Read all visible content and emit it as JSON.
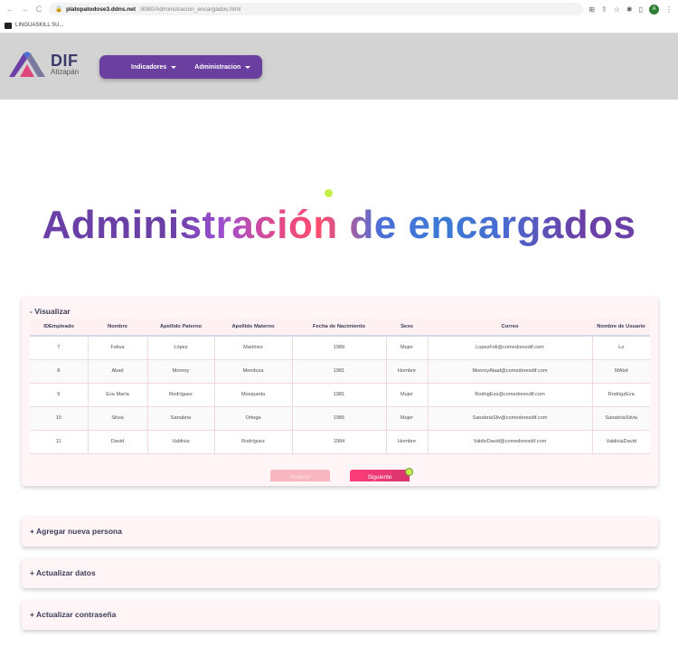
{
  "browser": {
    "url_host": "platopatodose3.ddns.net",
    "url_path": ":8080/Administracion_encargados.html",
    "profile_initial": "A",
    "bookmark": "LINGUASKILL SU..."
  },
  "header": {
    "logo_title": "DIF",
    "logo_subtitle": "Atizapán",
    "nav": [
      "Indicadores",
      "Administracion"
    ]
  },
  "hero": {
    "title": "Administración de encargados"
  },
  "visualizar": {
    "title": "- Visualizar",
    "columns": [
      "IDEmpleado",
      "Nombre",
      "Apellido Paterno",
      "Apellido Materno",
      "Fecha de Nacimiento",
      "Sexo",
      "Correo",
      "Nombre de Usuario"
    ],
    "rows": [
      [
        "7",
        "Felisa",
        "López",
        "Martínez",
        "1989",
        "Mujer",
        "LopezFeli@comedoresdif.com",
        "Lo"
      ],
      [
        "8",
        "Abad",
        "Monroy",
        "Mendoza",
        "1981",
        "Hombre",
        "MonroyAbad@comedoresdif.com",
        "MAbd"
      ],
      [
        "9",
        "Eva María",
        "Rodríguez",
        "Mosqueda",
        "1981",
        "Mujer",
        "RodrigEva@comedoresdif.com",
        "RodrigzEva"
      ],
      [
        "10",
        "Silvia",
        "Sanabria",
        "Ortega",
        "1985",
        "Mujer",
        "SanabriaSilv@comedoresdif.com",
        "SanabriaSilvia"
      ],
      [
        "11",
        "David",
        "Valdivia",
        "Rodríguez",
        "1984",
        "Hombre",
        "ValdivDavid@comedoresdif.com",
        "ValdiviaDavid"
      ]
    ],
    "prev_label": "Anterior",
    "next_label": "Siguiente"
  },
  "sections": {
    "agregar": "+ Agregar nueva persona",
    "actualizar": "+ Actualizar datos",
    "password": "+ Actualizar contraseña"
  },
  "colors": {
    "nav_purple": "#6b3fa0",
    "header_gray": "#d3d3d3",
    "next_button": "#ff3d7a",
    "panel_bg": "#fff5f6"
  }
}
